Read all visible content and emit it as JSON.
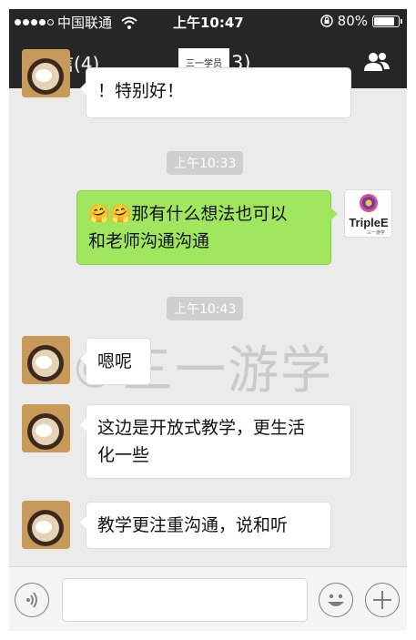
{
  "status": {
    "carrier": "中国联通",
    "time": "上午10:47",
    "battery_text": "80%",
    "battery_level": 0.8
  },
  "nav": {
    "back_label": "微信(4)",
    "title_masked": "三一学员",
    "title_suffix": "3)"
  },
  "messages": [
    {
      "side": "left",
      "text": "！特别好！"
    },
    {
      "time": "上午10:33"
    },
    {
      "side": "right",
      "text_line1": "那有什么想法也可以",
      "text_line2": "和老师沟通沟通",
      "emoji": "🤗🤗"
    },
    {
      "time": "上午10:43"
    },
    {
      "side": "left",
      "text": "嗯呢"
    },
    {
      "side": "left",
      "text_line1": "这边是开放式教学，更生活",
      "text_line2": "化一些"
    },
    {
      "side": "left",
      "text": "教学更注重沟通，说和听"
    }
  ],
  "brand_avatar": {
    "name": "TripleE",
    "sub": "三一游学"
  },
  "watermark": "©三一游学",
  "colors": {
    "topbar": "#262626",
    "green_bubble": "#a0e65e",
    "chat_bg": "#ebebeb"
  }
}
